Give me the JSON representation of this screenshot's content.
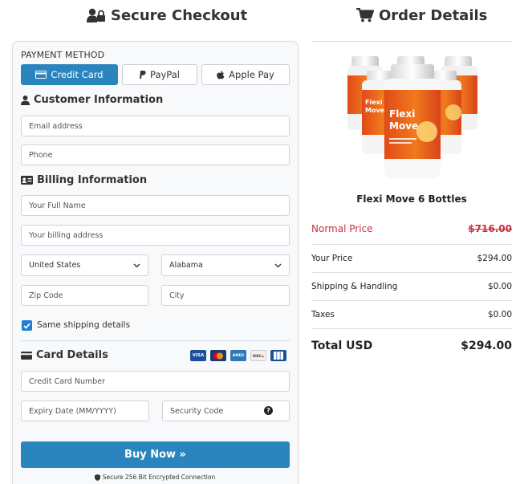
{
  "checkout": {
    "title": "Secure Checkout",
    "payment_method_label": "PAYMENT METHOD",
    "payment_methods": [
      {
        "label": "Credit Card",
        "active": true
      },
      {
        "label": "PayPal",
        "active": false
      },
      {
        "label": "Apple Pay",
        "active": false
      }
    ],
    "customer_section": "Customer Information",
    "email_placeholder": "Email address",
    "phone_placeholder": "Phone",
    "billing_section": "Billing Information",
    "name_placeholder": "Your Full Name",
    "address_placeholder": "Your billing address",
    "country_selected": "United States",
    "state_selected": "Alabama",
    "zip_placeholder": "Zip Code",
    "city_placeholder": "City",
    "same_shipping_label": "Same shipping details",
    "same_shipping_checked": true,
    "card_section": "Card Details",
    "card_logos": [
      "VISA",
      "Mastercard",
      "AMEX",
      "Discover",
      "JCB"
    ],
    "card_number_placeholder": "Credit Card Number",
    "expiry_placeholder": "Expiry Date (MM/YYYY)",
    "security_placeholder": "Security Code",
    "buy_button": "Buy Now »",
    "secure_note": "Secure 256 Bit Encrypted Connection",
    "accent_color": "#2a84bd"
  },
  "order": {
    "title": "Order Details",
    "product_name": "Flexi Move 6 Bottles",
    "product_label": "Flexi Move",
    "normal_price_label": "Normal Price",
    "normal_price": "$716.00",
    "your_price_label": "Your Price",
    "your_price": "$294.00",
    "shipping_label": "Shipping & Handling",
    "shipping": "$0.00",
    "taxes_label": "Taxes",
    "taxes": "$0.00",
    "total_label": "Total USD",
    "total": "$294.00",
    "normal_price_color": "#c9303f"
  }
}
